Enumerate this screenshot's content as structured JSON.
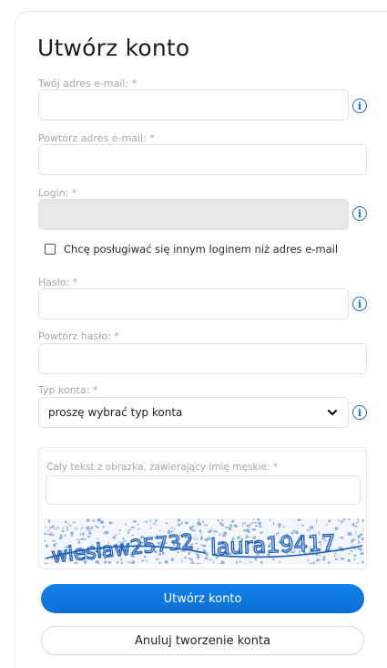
{
  "form": {
    "title": "Utwórz konto",
    "email_label": "Twój adres e-mail: *",
    "email_value": "",
    "email_repeat_label": "Powtórz adres e-mail: *",
    "email_repeat_value": "",
    "login_label": "Login: *",
    "login_value": "",
    "alt_login_checkbox_label": "Chcę posługiwać się innym loginem niż adres e-mail",
    "alt_login_checked": false,
    "password_label": "Hasło: *",
    "password_repeat_label": "Powtórz hasło: *",
    "account_type_label": "Typ konta: *",
    "account_type_selected": "proszę wybrać typ konta",
    "info_glyph": "i"
  },
  "captcha": {
    "label": "Cały tekst z obrazka, zawierający imię męskie: *",
    "value": "",
    "image_words": [
      "wiesław25732",
      "laura19417"
    ],
    "text_color": "#1d5fb8"
  },
  "buttons": {
    "submit_label": "Utwórz konto",
    "cancel_label": "Anuluj tworzenie konta"
  },
  "colors": {
    "accent": "#0b78e3",
    "info": "#1f6fc5",
    "disabled_field": "#e8e8e8"
  }
}
